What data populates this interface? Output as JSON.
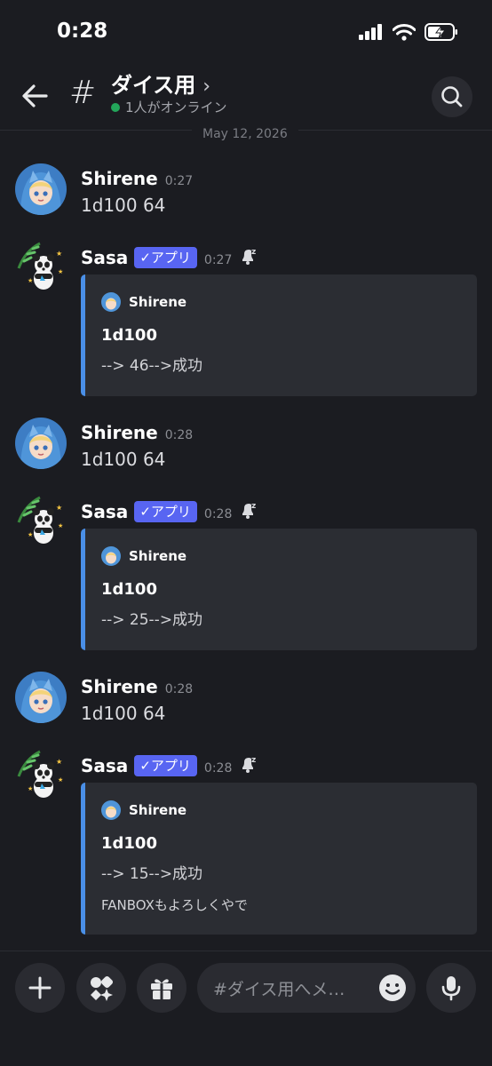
{
  "status_bar": {
    "time": "0:28"
  },
  "header": {
    "channel_name": "ダイス用",
    "online_text": "1人がオンライン"
  },
  "date_divider": "May 12, 2026",
  "messages": [
    {
      "author": "Shirene",
      "time": "0:27",
      "content": "1d100 64"
    },
    {
      "author": "Sasa",
      "badge": "アプリ",
      "time": "0:27",
      "embed": {
        "author": "Shirene",
        "title": "1d100",
        "description": "--> 46-->成功"
      }
    },
    {
      "author": "Shirene",
      "time": "0:28",
      "content": "1d100 64"
    },
    {
      "author": "Sasa",
      "badge": "アプリ",
      "time": "0:28",
      "embed": {
        "author": "Shirene",
        "title": "1d100",
        "description": "--> 25-->成功"
      }
    },
    {
      "author": "Shirene",
      "time": "0:28",
      "content": "1d100 64"
    },
    {
      "author": "Sasa",
      "badge": "アプリ",
      "time": "0:28",
      "embed": {
        "author": "Shirene",
        "title": "1d100",
        "description": "--> 15-->成功",
        "extra": "FANBOXもよろしくやで"
      }
    }
  ],
  "composer": {
    "placeholder": "#ダイス用へメ…"
  },
  "colors": {
    "online": "#23a55a",
    "app_badge": "#5865f2",
    "embed_bar": "#4a8fe7",
    "background": "#1b1c21"
  },
  "icons": [
    "back-arrow-icon",
    "hash-icon",
    "chevron-right-icon",
    "search-icon",
    "bell-snooze-icon",
    "plus-icon",
    "apps-icon",
    "gift-icon",
    "emoji-icon",
    "microphone-icon",
    "signal-icon",
    "wifi-icon",
    "battery-icon"
  ]
}
